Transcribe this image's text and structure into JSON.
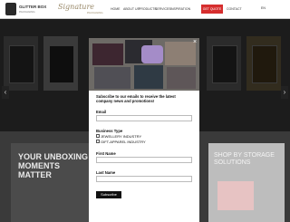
{
  "header": {
    "brand_name": "GLITTER BOX",
    "brand_sub": "PACKAGING",
    "script_brand": "Signature",
    "script_sub": "PACKAGING",
    "nav_items": [
      "HOME",
      "ABOUT US",
      "PRODUCTS",
      "SERVICES",
      "INSPIRATION",
      "CONTACT"
    ],
    "cta_label": "GET QUOTE",
    "language": "EN"
  },
  "background": {
    "left_panel_title": "YOUR UNBOXING MOMENTS MATTER",
    "right_panel_title": "SHOP BY STORAGE SOLUTIONS",
    "prev_arrow": "‹",
    "next_arrow": "›"
  },
  "popup": {
    "intro": "Subscribe to our emails to receive the latest company news and promotions!",
    "email_label": "Email",
    "email_value": "",
    "business_type_label": "Business Type",
    "options": [
      "JEWELLERY INDUSTRY",
      "GIFT-APPAREL INDUSTRY"
    ],
    "first_name_label": "First Name",
    "first_name_value": "",
    "last_name_label": "Last Name",
    "last_name_value": "",
    "submit_label": "Subscribe",
    "close_glyph": "×"
  },
  "colors": {
    "cta": "#d62e2e",
    "popup_bg": "#ffffff",
    "submit_bg": "#111111"
  }
}
